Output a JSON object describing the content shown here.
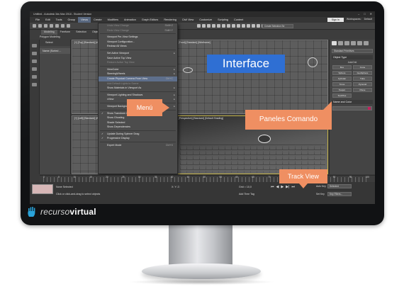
{
  "app": {
    "title": "Untitled - Autodesk 3ds Max 2018 - Student Version",
    "window_buttons": [
      "–",
      "□",
      "✕"
    ]
  },
  "menubar": {
    "items": [
      "File",
      "Edit",
      "Tools",
      "Group",
      "Views",
      "Create",
      "Modifiers",
      "Animation",
      "Graph Editors",
      "Rendering",
      "Civil View",
      "Customize",
      "Scripting",
      "Content"
    ],
    "active_index": 4,
    "signin": "Sign In",
    "workspaces_label": "Workspaces:",
    "workspaces_value": "Default"
  },
  "toolbar": {
    "selection_set": "Create Selection Se"
  },
  "ribbon": {
    "tabs": [
      "Modeling",
      "Freeform",
      "Selection",
      "Object Paint",
      "Populate"
    ],
    "active_index": 0,
    "subtitle": "Polygon Modeling"
  },
  "explorer": {
    "header": "Select",
    "row": "Name (Sorted ..."
  },
  "viewports": {
    "top": "[+] [Top] [Standard] [Wireframe]",
    "front": "[+] [Front] [Standard] [Wireframe]",
    "left": "[+] [Left] [Standard] [Wireframe]",
    "perspective": "[+] [Perspective] [Standard] [Default Shading]"
  },
  "views_menu": {
    "items": [
      {
        "label": "Undo View Change",
        "shortcut": "Shift+Z",
        "dim": true
      },
      {
        "label": "Redo View Change",
        "shortcut": "Shift+Y",
        "dim": true
      },
      {
        "sep": true
      },
      {
        "label": "Viewport Per-View Settings"
      },
      {
        "label": "Viewport Configuration..."
      },
      {
        "label": "Redraw All Views"
      },
      {
        "sep": true
      },
      {
        "label": "Set Active Viewport",
        "arrow": true
      },
      {
        "label": "Save Active Top View"
      },
      {
        "label": "Restore Active Top View",
        "dim": true
      },
      {
        "sep": true
      },
      {
        "label": "ViewCube",
        "arrow": true
      },
      {
        "label": "SteeringWheels",
        "arrow": true
      },
      {
        "label": "Create Physical Camera From View",
        "shortcut": "Ctrl+C",
        "highlight": true
      },
      {
        "label": "Add Default Lights to Scene",
        "dim": true
      },
      {
        "label": "Show Materials in Viewport As",
        "arrow": true
      },
      {
        "sep": true
      },
      {
        "label": "Viewport Lighting and Shadows",
        "arrow": true
      },
      {
        "label": "xView",
        "arrow": true
      },
      {
        "sep": true
      },
      {
        "label": "Viewport Background",
        "arrow": true
      },
      {
        "sep": true
      },
      {
        "label": "Show Transform Gizmo",
        "check": true
      },
      {
        "label": "Show Ghosting"
      },
      {
        "label": "Shade Selected"
      },
      {
        "label": "Show Dependencies"
      },
      {
        "sep": true
      },
      {
        "label": "Update During Spinner Drag",
        "check": true
      },
      {
        "label": "Progressive Display",
        "check": true
      },
      {
        "sep": true
      },
      {
        "label": "Expert Mode",
        "shortcut": "Ctrl+X"
      }
    ]
  },
  "command_panel": {
    "category": "Standard Primitives",
    "object_type_header": "Object Type",
    "autogrid": "AutoGrid",
    "buttons": [
      "Box",
      "Cone",
      "Sphere",
      "GeoSphere",
      "Cylinder",
      "Tube",
      "Torus",
      "Pyramid",
      "Teapot",
      "Plane",
      "TextPlus"
    ],
    "name_color_header": "Name and Color",
    "swatch_color": "#c2205d"
  },
  "timeline": {
    "frame_labels": [
      "0",
      "5",
      "10",
      "15",
      "20",
      "25",
      "30",
      "35",
      "40",
      "45",
      "50",
      "55",
      "60",
      "65",
      "70",
      "75",
      "80",
      "85",
      "90",
      "95",
      "100"
    ]
  },
  "status": {
    "selection": "None Selected",
    "prompt": "Click or click-and-drag to select objects",
    "coords": "X:   Y:   Z:",
    "grid": "Grid = 10,0",
    "add_time_tag": "Add Time Tag",
    "auto_key": "Auto Key",
    "selected": "Selected",
    "set_key": "Set Key",
    "key_filters": "Key Filters...",
    "play_controls": [
      "⏮",
      "◀",
      "▶",
      "▶|",
      "⏭"
    ]
  },
  "callouts": {
    "interface": "Interface",
    "menu": "Menú",
    "paneles": "Paneles Comando",
    "track_view": "Track View"
  },
  "brand": {
    "part1": "recurso",
    "part2": "virtual"
  },
  "colors": {
    "callout_blue": "#2f6fd3",
    "callout_orange": "#ef8f62",
    "menu_highlight": "#5e6f8c"
  }
}
